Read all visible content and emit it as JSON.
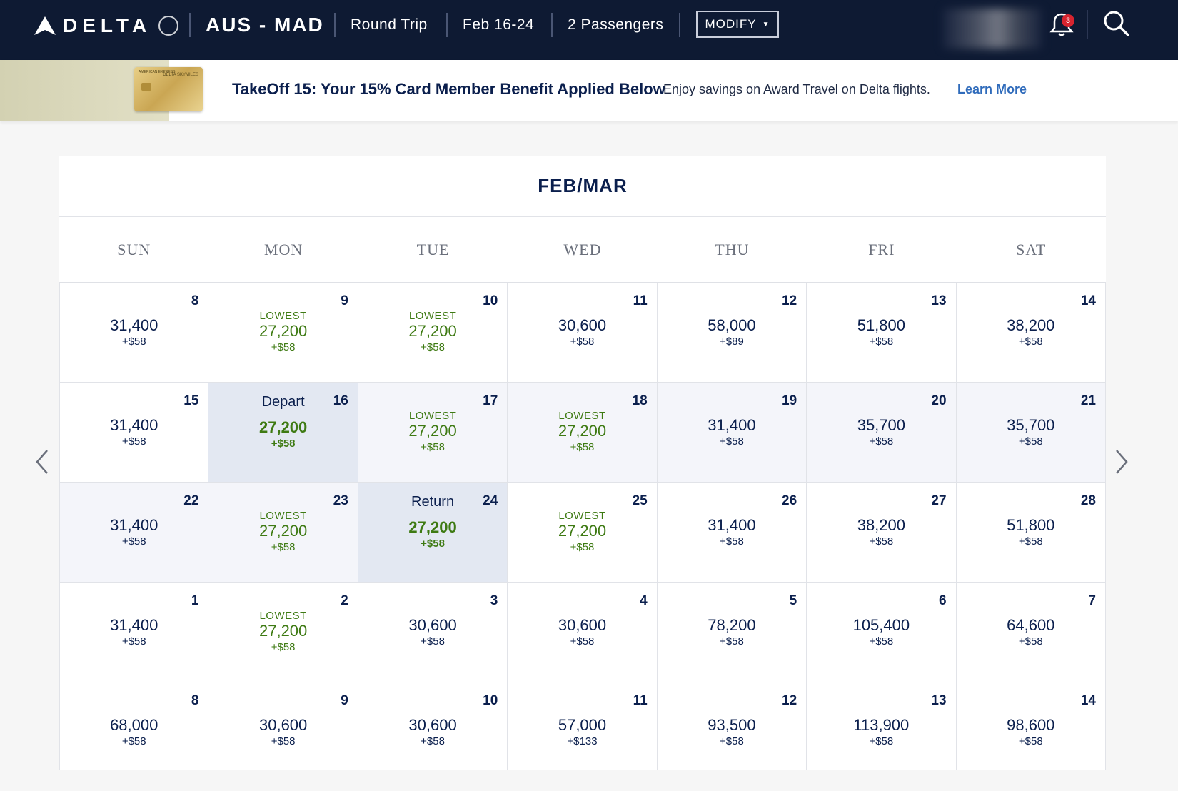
{
  "header": {
    "logo_text": "DELTA",
    "route": "AUS - MAD",
    "trip_type": "Round Trip",
    "dates": "Feb 16-24",
    "passengers": "2 Passengers",
    "modify_label": "MODIFY",
    "notification_count": "3",
    "background_color": "#0e1a33"
  },
  "promo": {
    "title": "TakeOff 15: Your 15% Card Member Benefit Applied Below",
    "subtitle": "Enjoy savings on Award Travel on Delta flights.",
    "link": "Learn More",
    "card_bank_text": "AMERICAN EXPRESS",
    "card_brand_text": "DELTA SKYMILES"
  },
  "calendar": {
    "title": "FEB/MAR",
    "days_of_week": [
      "SUN",
      "MON",
      "TUE",
      "WED",
      "THU",
      "FRI",
      "SAT"
    ],
    "lowest_label": "LOWEST",
    "lowest_color": "#3e7a13",
    "cells": [
      {
        "day": "8",
        "miles": "31,400",
        "fee": "+$58"
      },
      {
        "day": "9",
        "miles": "27,200",
        "fee": "+$58",
        "lowest": true
      },
      {
        "day": "10",
        "miles": "27,200",
        "fee": "+$58",
        "lowest": true
      },
      {
        "day": "11",
        "miles": "30,600",
        "fee": "+$58"
      },
      {
        "day": "12",
        "miles": "58,000",
        "fee": "+$89"
      },
      {
        "day": "13",
        "miles": "51,800",
        "fee": "+$58"
      },
      {
        "day": "14",
        "miles": "38,200",
        "fee": "+$58"
      },
      {
        "day": "15",
        "miles": "31,400",
        "fee": "+$58"
      },
      {
        "day": "16",
        "miles": "27,200",
        "fee": "+$58",
        "selected": true,
        "tag": "Depart"
      },
      {
        "day": "17",
        "miles": "27,200",
        "fee": "+$58",
        "lowest": true,
        "inrange": true
      },
      {
        "day": "18",
        "miles": "27,200",
        "fee": "+$58",
        "lowest": true,
        "inrange": true
      },
      {
        "day": "19",
        "miles": "31,400",
        "fee": "+$58",
        "inrange": true
      },
      {
        "day": "20",
        "miles": "35,700",
        "fee": "+$58",
        "inrange": true
      },
      {
        "day": "21",
        "miles": "35,700",
        "fee": "+$58",
        "inrange": true
      },
      {
        "day": "22",
        "miles": "31,400",
        "fee": "+$58",
        "inrange": true
      },
      {
        "day": "23",
        "miles": "27,200",
        "fee": "+$58",
        "lowest": true,
        "inrange": true
      },
      {
        "day": "24",
        "miles": "27,200",
        "fee": "+$58",
        "selected": true,
        "tag": "Return"
      },
      {
        "day": "25",
        "miles": "27,200",
        "fee": "+$58",
        "lowest": true
      },
      {
        "day": "26",
        "miles": "31,400",
        "fee": "+$58"
      },
      {
        "day": "27",
        "miles": "38,200",
        "fee": "+$58"
      },
      {
        "day": "28",
        "miles": "51,800",
        "fee": "+$58"
      },
      {
        "day": "1",
        "miles": "31,400",
        "fee": "+$58"
      },
      {
        "day": "2",
        "miles": "27,200",
        "fee": "+$58",
        "lowest": true
      },
      {
        "day": "3",
        "miles": "30,600",
        "fee": "+$58"
      },
      {
        "day": "4",
        "miles": "30,600",
        "fee": "+$58"
      },
      {
        "day": "5",
        "miles": "78,200",
        "fee": "+$58"
      },
      {
        "day": "6",
        "miles": "105,400",
        "fee": "+$58"
      },
      {
        "day": "7",
        "miles": "64,600",
        "fee": "+$58"
      },
      {
        "day": "8",
        "miles": "68,000",
        "fee": "+$58"
      },
      {
        "day": "9",
        "miles": "30,600",
        "fee": "+$58"
      },
      {
        "day": "10",
        "miles": "30,600",
        "fee": "+$58"
      },
      {
        "day": "11",
        "miles": "57,000",
        "fee": "+$133"
      },
      {
        "day": "12",
        "miles": "93,500",
        "fee": "+$58"
      },
      {
        "day": "13",
        "miles": "113,900",
        "fee": "+$58"
      },
      {
        "day": "14",
        "miles": "98,600",
        "fee": "+$58"
      }
    ]
  }
}
